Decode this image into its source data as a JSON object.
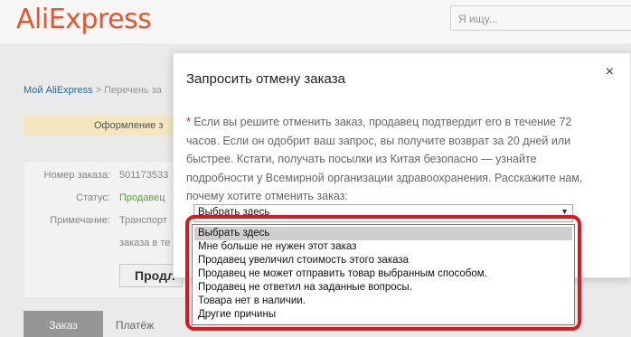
{
  "header": {
    "logo": "AliExpress",
    "search_placeholder": "Я ищу..."
  },
  "background": {
    "breadcrumb_home": "Мой AliExpress",
    "breadcrumb_rest": " > Перечень за",
    "step_label": "Оформление з",
    "order_number_label": "Номер заказа:",
    "order_number_value": "501173533",
    "status_label": "Статус:",
    "status_value": "Продавец",
    "note_label": "Примечание:",
    "note_value_line1": "Транспорт",
    "note_value_line2": "заказа в те",
    "product_button": "Продл",
    "tabs": [
      "Заказ",
      "Платёж"
    ]
  },
  "modal": {
    "title": "Запросить отмену заказа",
    "close": "×",
    "asterisk": "*",
    "text": " Если вы решите отменить заказ, продавец подтвердит его в течение 72 часов. Если он одобрит ваш запрос, вы получите возврат за 20 дней или быстрее. Кстати, получать посылки из Китая безопасно — узнайте подробности у Всемирной организации здравоохранения. Расскажите нам, почему хотите отменить заказ:",
    "select_value": "Выбрать здесь",
    "options": [
      "Выбрать здесь",
      "Мне больше не нужен этот заказ",
      "Продавец увеличил стоимость этого заказа",
      "Продавец не может отправить товар выбранным способом.",
      "Продавец не ответил на заданные вопросы.",
      "Товара нет в наличии.",
      "Другие причины"
    ]
  },
  "colors": {
    "brand": "#f5562c",
    "highlight": "#e1151b",
    "status_green": "#5aaa3a"
  }
}
